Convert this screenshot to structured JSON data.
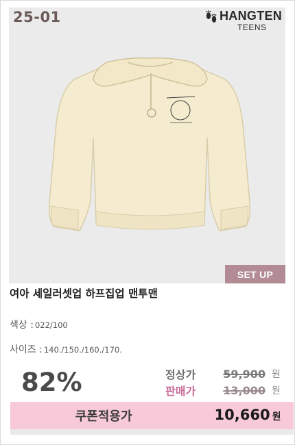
{
  "product": {
    "code": "25-01",
    "brand_name": "HANGTEN",
    "brand_sub": "TEENS",
    "tag": "SET UP",
    "title": "여아 세일러셋업 하프집업 맨투맨",
    "color_label": "색상 :",
    "color_value": "022/100",
    "size_label": "사이즈 :",
    "size_value": "140./150./160./170."
  },
  "pricing": {
    "discount": "82%",
    "regular_label": "정상가",
    "regular_price": "59,900",
    "sale_label": "판매가",
    "sale_price": "13,000",
    "currency": "원",
    "coupon_label": "쿠폰적용가",
    "coupon_price": "10,660",
    "coupon_currency": "원"
  },
  "colors": {
    "tag_bg": "#b28b95",
    "sale_label": "#c86b9a",
    "coupon_bg": "#f7c9d9",
    "photo_bg": "#ebebeb",
    "garment": "#f5ecd0"
  }
}
